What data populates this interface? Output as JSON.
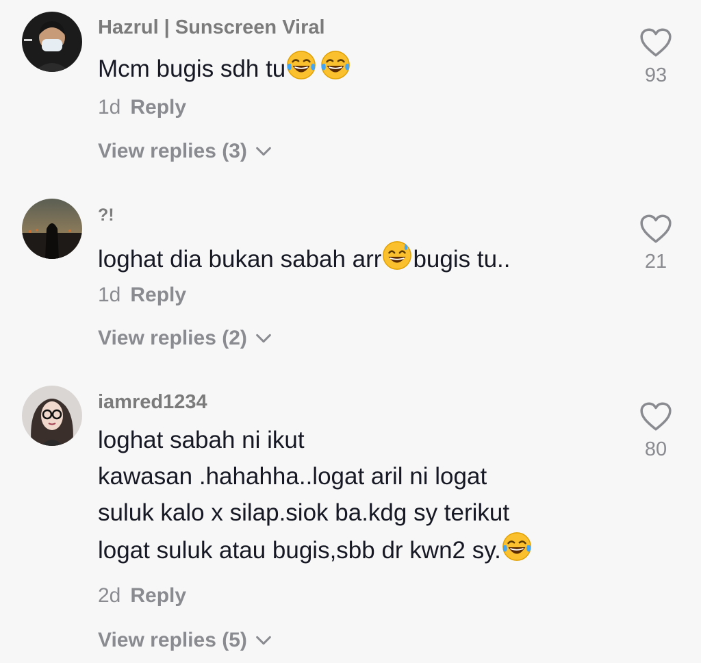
{
  "comments": [
    {
      "username": "Hazrul | Sunscreen Viral",
      "text": "Mcm bugis sdh tu",
      "time": "1d",
      "reply_label": "Reply",
      "view_replies": "View replies (3)",
      "likes": "93",
      "emojis": [
        "face-with-tears-of-joy-icon",
        "face-with-tears-of-joy-icon"
      ]
    },
    {
      "username": "?!",
      "text_before": "loghat dia bukan sabah arr",
      "text_after": "bugis tu..",
      "time": "1d",
      "reply_label": "Reply",
      "view_replies": "View replies (2)",
      "likes": "21",
      "emojis": [
        "grinning-face-with-sweat-icon"
      ]
    },
    {
      "username": "iamred1234",
      "lines": [
        "loghat sabah ni ikut",
        "kawasan .hahahha..logat aril ni logat",
        "suluk kalo x silap.siok ba.kdg sy terikut",
        "logat suluk atau bugis,sbb dr kwn2 sy."
      ],
      "time": "2d",
      "reply_label": "Reply",
      "view_replies": "View replies (5)",
      "likes": "80",
      "emojis": [
        "face-with-tears-of-joy-icon"
      ]
    }
  ],
  "colors": {
    "background": "#f7f7f7",
    "text": "#161823",
    "secondary": "#8a8b91"
  }
}
